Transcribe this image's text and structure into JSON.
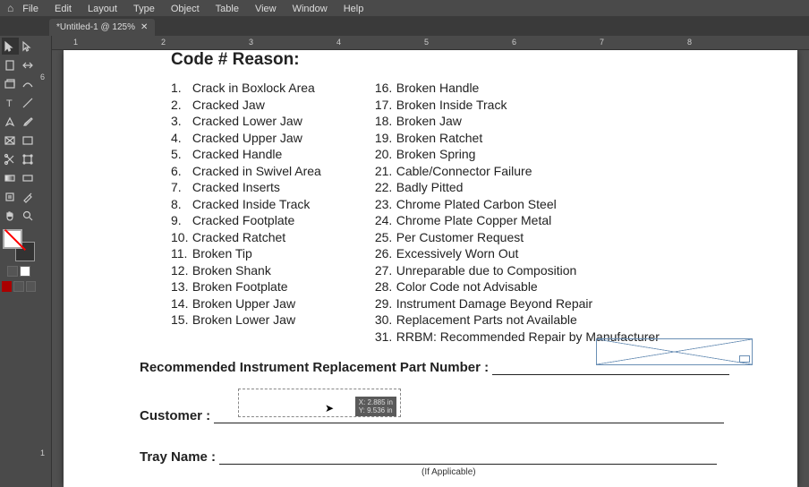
{
  "menu": [
    "File",
    "Edit",
    "Layout",
    "Type",
    "Object",
    "Table",
    "View",
    "Window",
    "Help"
  ],
  "tab": {
    "title": "*Untitled-1 @ 125%"
  },
  "rulerH": [
    "1",
    "2",
    "3",
    "4",
    "5",
    "6",
    "7",
    "8"
  ],
  "rulerV": [
    "6",
    "1"
  ],
  "document": {
    "heading": "Code # Reason:",
    "leftReasons": [
      {
        "n": "1.",
        "t": "Crack in Boxlock Area"
      },
      {
        "n": "2.",
        "t": "Cracked Jaw"
      },
      {
        "n": "3.",
        "t": "Cracked Lower Jaw"
      },
      {
        "n": "4.",
        "t": "Cracked Upper Jaw"
      },
      {
        "n": "5.",
        "t": "Cracked Handle"
      },
      {
        "n": "6.",
        "t": "Cracked in Swivel Area"
      },
      {
        "n": "7.",
        "t": "Cracked Inserts"
      },
      {
        "n": "8.",
        "t": "Cracked Inside Track"
      },
      {
        "n": "9.",
        "t": "Cracked Footplate"
      },
      {
        "n": "10.",
        "t": "Cracked Ratchet"
      },
      {
        "n": "11.",
        "t": "Broken Tip"
      },
      {
        "n": "12.",
        "t": "Broken Shank"
      },
      {
        "n": "13.",
        "t": "Broken Footplate"
      },
      {
        "n": "14.",
        "t": "Broken Upper Jaw"
      },
      {
        "n": "15.",
        "t": "Broken Lower Jaw"
      }
    ],
    "rightReasons": [
      {
        "n": "16.",
        "t": "Broken Handle"
      },
      {
        "n": "17.",
        "t": "Broken Inside Track"
      },
      {
        "n": "18.",
        "t": "Broken Jaw"
      },
      {
        "n": "19.",
        "t": "Broken Ratchet"
      },
      {
        "n": "20.",
        "t": "Broken Spring"
      },
      {
        "n": "21.",
        "t": "Cable/Connector Failure"
      },
      {
        "n": "22.",
        "t": "Badly Pitted"
      },
      {
        "n": "23.",
        "t": "Chrome Plated Carbon Steel"
      },
      {
        "n": "24.",
        "t": "Chrome Plate Copper Metal"
      },
      {
        "n": "25.",
        "t": "Per Customer Request"
      },
      {
        "n": "26.",
        "t": "Excessively Worn Out"
      },
      {
        "n": "27.",
        "t": "Unreparable due to Composition"
      },
      {
        "n": "28.",
        "t": "Color Code not Advisable"
      },
      {
        "n": "29.",
        "t": "Instrument Damage Beyond Repair"
      },
      {
        "n": "30.",
        "t": "Replacement Parts not Available"
      },
      {
        "n": "31.",
        "t": "RRBM: Recommended Repair by Manufacturer"
      }
    ],
    "partLabel": "Recommended Instrument Replacement Part Number :",
    "customerLabel": "Customer :",
    "trayLabel": "Tray Name :",
    "applicable": "(If Applicable)",
    "selectionHint1": "X: 2.885 in",
    "selectionHint2": "Y: 9.536 in"
  }
}
